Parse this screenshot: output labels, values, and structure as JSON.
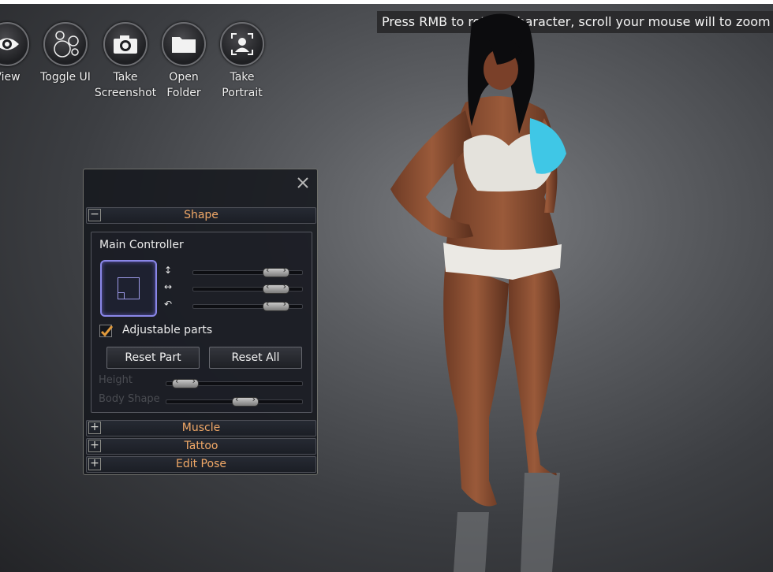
{
  "toolbar": {
    "items": [
      {
        "label": "View",
        "icon": "eye-icon"
      },
      {
        "label": "Toggle UI",
        "icon": "circles-icon"
      },
      {
        "label": "Take\nScreenshot",
        "icon": "camera-icon"
      },
      {
        "label": "Open\nFolder",
        "icon": "folder-icon"
      },
      {
        "label": "Take\nPortrait",
        "icon": "portrait-icon"
      }
    ]
  },
  "hint": "Press RMB to rotate character, scroll your mouse will to zoom in/out",
  "panel": {
    "sections": {
      "shape": {
        "label": "Shape",
        "toggle": "−"
      },
      "muscle": {
        "label": "Muscle",
        "toggle": "+"
      },
      "tattoo": {
        "label": "Tattoo",
        "toggle": "+"
      },
      "edit_pose": {
        "label": "Edit Pose",
        "toggle": "+"
      }
    },
    "main_controller": {
      "title": "Main Controller",
      "axes": [
        {
          "icon": "↕",
          "value": 0.85
        },
        {
          "icon": "↔",
          "value": 0.85
        },
        {
          "icon": "↶",
          "value": 0.85
        }
      ],
      "adjustable_parts": {
        "label": "Adjustable parts",
        "checked": true
      },
      "reset_part": "Reset Part",
      "reset_all": "Reset All",
      "height": {
        "label": "Height",
        "value": 0.05
      },
      "body_shape": {
        "label": "Body Shape",
        "value": 0.6
      }
    }
  },
  "colors": {
    "accent": "#f0a867",
    "pad_border": "#8a87e8",
    "check": "#e19a3c"
  }
}
